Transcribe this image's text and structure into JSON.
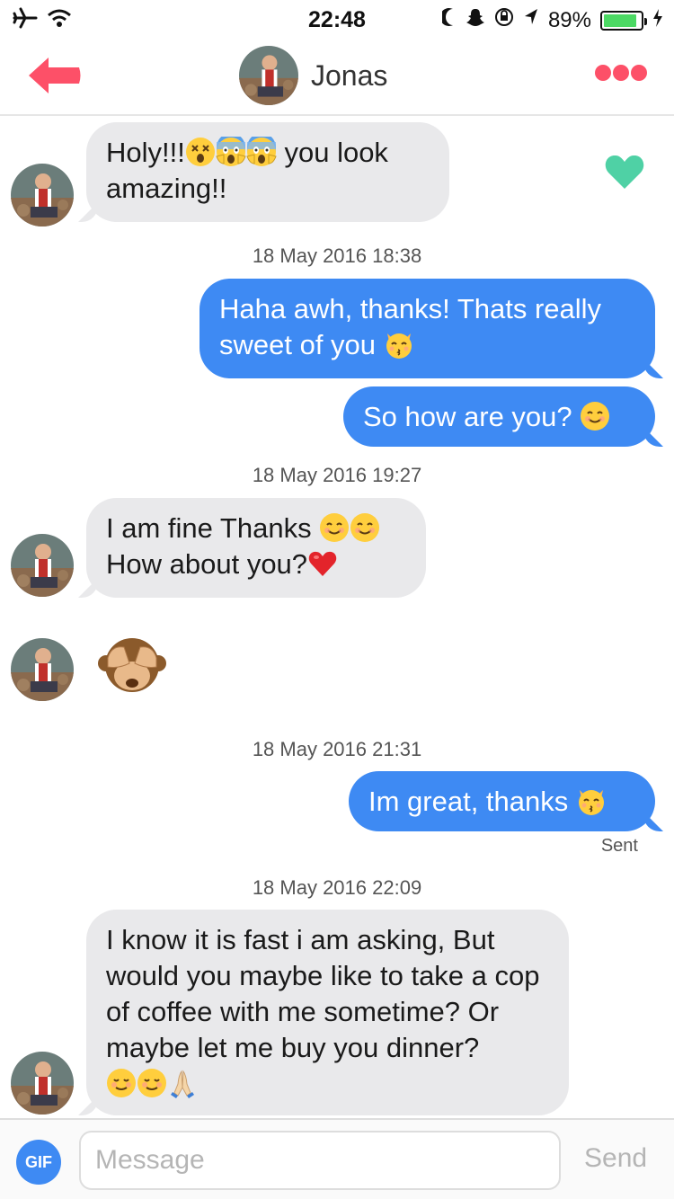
{
  "status_bar": {
    "time": "22:48",
    "battery_text": "89%",
    "battery_level": 0.89,
    "icons": [
      "airplane-icon",
      "wifi-icon",
      "moon-icon",
      "snapchat-icon",
      "rotation-lock-icon",
      "location-icon",
      "battery-icon",
      "charging-bolt-icon"
    ]
  },
  "header": {
    "name": "Jonas",
    "icons": [
      "back-arrow-icon",
      "more-dots-icon"
    ]
  },
  "messages": {
    "m1": {
      "part1": "Holy!!!",
      "part2": " you look amazing!!",
      "emoji": [
        "dizzy-face-emoji",
        "scream-emoji",
        "scream-emoji"
      ]
    },
    "ts1": "18 May 2016 18:38",
    "m2": {
      "text": "Haha awh, thanks! Thats really sweet of you",
      "emoji": [
        "kissing-cat-emoji"
      ]
    },
    "m3": {
      "text": "So how are you?",
      "emoji": [
        "smiling-face-emoji"
      ]
    },
    "ts2": "18 May 2016 19:27",
    "m4": {
      "line1": "I am fine Thanks",
      "line2": "How about you?",
      "emoji": [
        "smiling-face-emoji",
        "smiling-face-emoji",
        "red-heart-emoji"
      ]
    },
    "m5": {
      "emoji": [
        "see-no-evil-monkey-emoji"
      ]
    },
    "ts3": "18 May 2016 21:31",
    "m6": {
      "text": "Im great, thanks",
      "emoji": [
        "kissing-cat-emoji"
      ]
    },
    "sent": "Sent",
    "ts4": "18 May 2016 22:09",
    "m7": {
      "text": "I know it is fast i am asking, But would you maybe like to take a cop of coffee with me sometime? Or maybe let me buy you dinner?",
      "emoji": [
        "relieved-face-emoji",
        "relieved-face-emoji",
        "folded-hands-emoji"
      ]
    }
  },
  "liked_icon": "heart-icon",
  "colors": {
    "accent": "#fd5068",
    "outgoing_bubble": "#3e8af3",
    "incoming_bubble": "#e9e9eb",
    "like_heart": "#4fd1a5"
  },
  "composer": {
    "gif_label": "GIF",
    "placeholder": "Message",
    "send_label": "Send"
  }
}
